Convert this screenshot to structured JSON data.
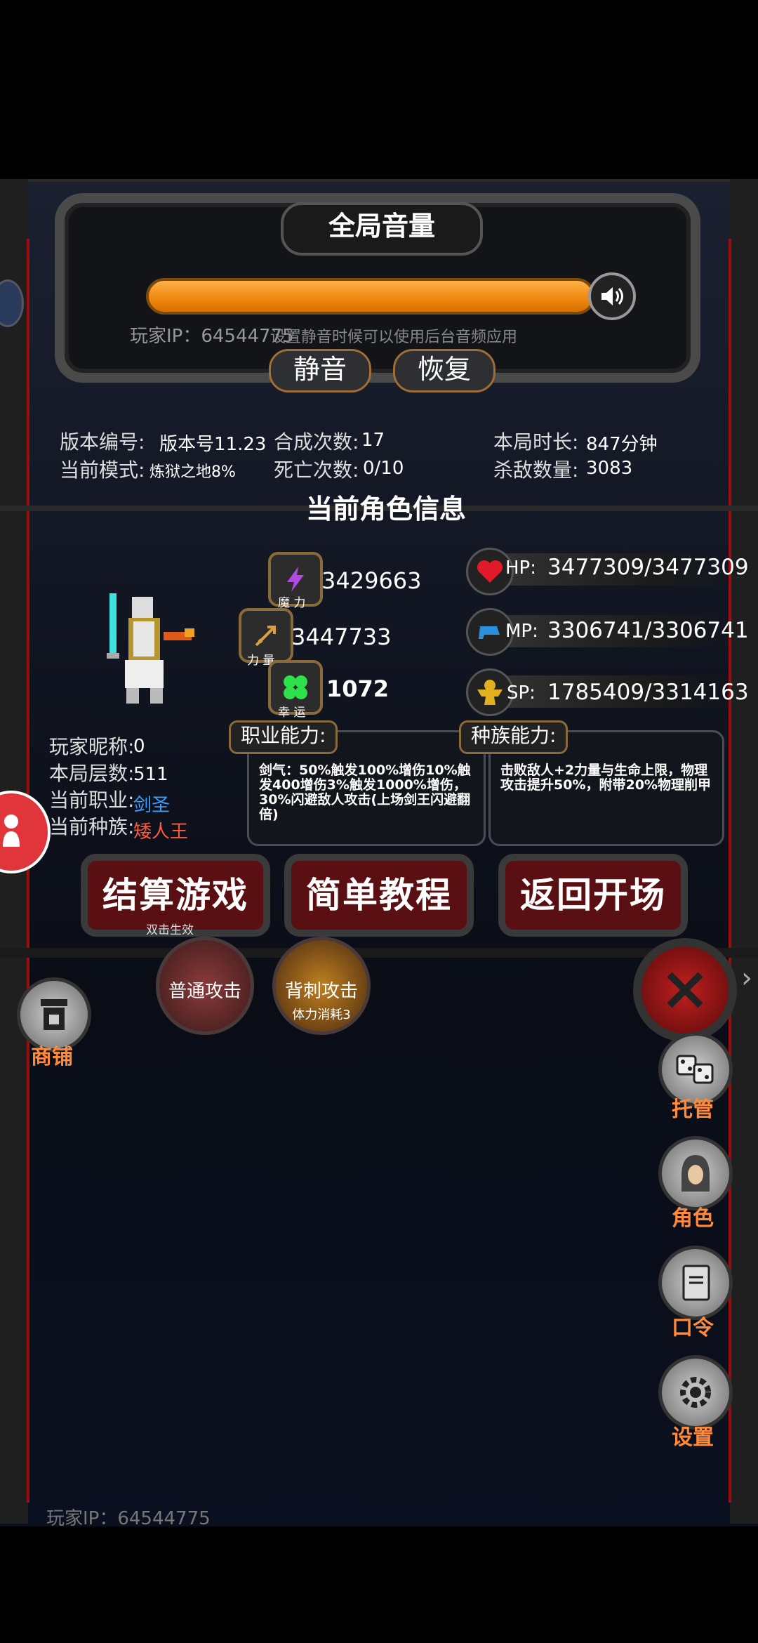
{
  "volume": {
    "title": "全局音量",
    "hint": "设置静音时候可以使用后台音频应用",
    "player_ip_overlay": "玩家IP：64544775",
    "mute_label": "静音",
    "restore_label": "恢复",
    "level": 0.95
  },
  "game_info": {
    "version_label": "版本编号:",
    "version_value": "版本号11.23",
    "mode_label": "当前模式:",
    "mode_value": "炼狱之地8%",
    "merge_label": "合成次数:",
    "merge_value": "17",
    "death_label": "死亡次数:",
    "death_value": "0/10",
    "duration_label": "本局时长:",
    "duration_value": "847分钟",
    "kills_label": "杀敌数量:",
    "kills_value": "3083"
  },
  "character": {
    "section_title": "当前角色信息",
    "magic_value": "3429663",
    "magic_label": "魔 力",
    "strength_value": "3447733",
    "strength_label": "力 量",
    "luck_value": "1072",
    "luck_label": "幸 运",
    "hp_label": "HP:",
    "hp_value": "3477309/3477309",
    "mp_label": "MP:",
    "mp_value": "3306741/3306741",
    "sp_label": "SP:",
    "sp_value": "1785409/3314163",
    "nickname_label": "玩家昵称:",
    "nickname_value": "0",
    "floor_label": "本局层数:",
    "floor_value": "511",
    "job_label": "当前职业:",
    "job_value": "剑圣",
    "race_label": "当前种族:",
    "race_value": "矮人王",
    "job_ability_label": "职业能力:",
    "job_ability_text": "剑气：50%触发100%增伤10%触发400增伤3%触发1000%增伤，30%闪避敌人攻击(上场剑王闪避翻倍)",
    "race_ability_label": "种族能力:",
    "race_ability_text": "击败敌人+2力量与生命上限，物理攻击提升50%，附带20%物理削甲"
  },
  "actions": {
    "settle_label": "结算游戏",
    "settle_sub": "双击生效",
    "tutorial_label": "简单教程",
    "back_label": "返回开场"
  },
  "skills": {
    "normal_attack": "普通攻击",
    "backstab": "背刺攻击",
    "backstab_sub": "体力消耗3"
  },
  "side": {
    "shop": "商铺",
    "auto": "托管",
    "role": "角色",
    "code": "口令",
    "settings": "设置"
  },
  "footer": {
    "player_ip": "玩家IP：64544775"
  },
  "colors": {
    "accent_orange": "#ff8a3a",
    "job_blue": "#3aa0ff",
    "race_red": "#ff5a3a",
    "button_red": "#5a0f12"
  }
}
